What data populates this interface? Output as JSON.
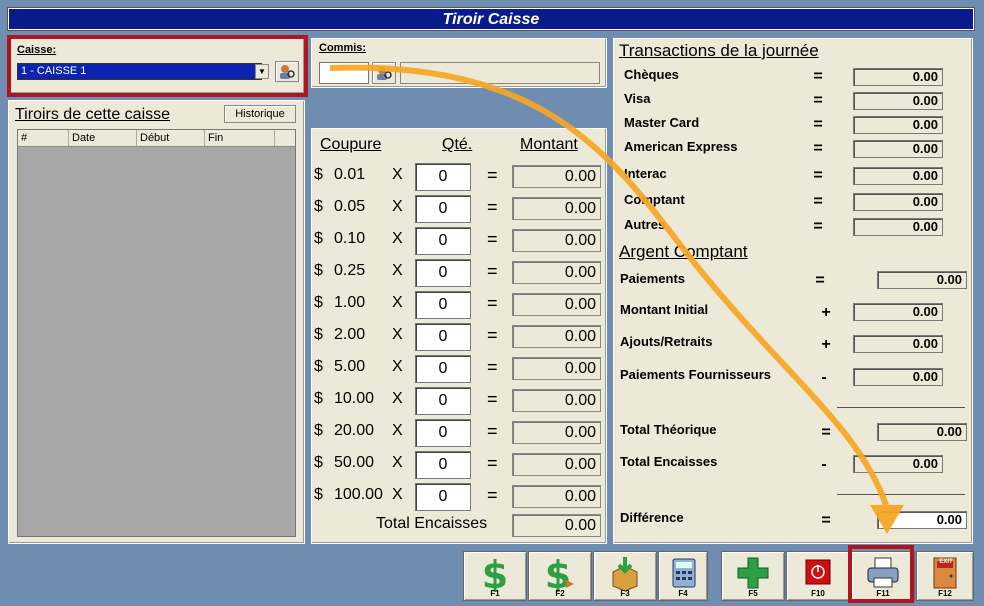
{
  "window_title": "Tiroir Caisse",
  "caisse": {
    "label": "Caisse:",
    "selected": "1 - CAISSE 1"
  },
  "commis": {
    "label": "Commis:",
    "code": "",
    "name": ""
  },
  "drawers": {
    "title": "Tiroirs de cette caisse",
    "history_button": "Historique",
    "columns": [
      "#",
      "Date",
      "Début",
      "Fin"
    ]
  },
  "count": {
    "headers": {
      "coupure": "Coupure",
      "qte": "Qté.",
      "montant": "Montant"
    },
    "currency": "$",
    "times": "X",
    "equals": "=",
    "rows": [
      {
        "coupure": "0.01",
        "qty": "0",
        "amount": "0.00"
      },
      {
        "coupure": "0.05",
        "qty": "0",
        "amount": "0.00"
      },
      {
        "coupure": "0.10",
        "qty": "0",
        "amount": "0.00"
      },
      {
        "coupure": "0.25",
        "qty": "0",
        "amount": "0.00"
      },
      {
        "coupure": "1.00",
        "qty": "0",
        "amount": "0.00"
      },
      {
        "coupure": "2.00",
        "qty": "0",
        "amount": "0.00"
      },
      {
        "coupure": "5.00",
        "qty": "0",
        "amount": "0.00"
      },
      {
        "coupure": "10.00",
        "qty": "0",
        "amount": "0.00"
      },
      {
        "coupure": "20.00",
        "qty": "0",
        "amount": "0.00"
      },
      {
        "coupure": "50.00",
        "qty": "0",
        "amount": "0.00"
      },
      {
        "coupure": "100.00",
        "qty": "0",
        "amount": "0.00"
      }
    ],
    "total_label": "Total Encaisses",
    "total_value": "0.00"
  },
  "transactions": {
    "title": "Transactions de la journée",
    "rows": [
      {
        "label": "Chèques",
        "op": "=",
        "value": "0.00"
      },
      {
        "label": "Visa",
        "op": "=",
        "value": "0.00"
      },
      {
        "label": "Master Card",
        "op": "=",
        "value": "0.00"
      },
      {
        "label": "American Express",
        "op": "=",
        "value": "0.00"
      },
      {
        "label": "Interac",
        "op": "=",
        "value": "0.00"
      },
      {
        "label": "Comptant",
        "op": "=",
        "value": "0.00"
      },
      {
        "label": "Autres",
        "op": "=",
        "value": "0.00"
      }
    ]
  },
  "cash": {
    "title": "Argent Comptant",
    "paiements": {
      "label": "Paiements",
      "op": "=",
      "value": "0.00"
    },
    "initial": {
      "label": "Montant Initial",
      "op": "+",
      "value": "0.00"
    },
    "ajouts": {
      "label": "Ajouts/Retraits",
      "op": "+",
      "value": "0.00"
    },
    "fournisseurs": {
      "label": "Paiements Fournisseurs",
      "op": "-",
      "value": "0.00"
    },
    "theorique": {
      "label": "Total Théorique",
      "op": "=",
      "value": "0.00"
    },
    "encaisses": {
      "label": "Total Encaisses",
      "op": "-",
      "value": "0.00"
    },
    "difference": {
      "label": "Différence",
      "op": "=",
      "value": "0.00"
    }
  },
  "toolbar": {
    "f1": "F1",
    "f2": "F2",
    "f3": "F3",
    "f4": "F4",
    "f5": "F5",
    "f10": "F10",
    "f11": "F11",
    "f12": "F12",
    "exit_text": "EXIT"
  },
  "colors": {
    "title_bar": "#0a1a8a",
    "highlight": "#b0141e",
    "arrow": "#f5a623",
    "money_green": "#2ea043",
    "stop_red": "#d01010"
  }
}
